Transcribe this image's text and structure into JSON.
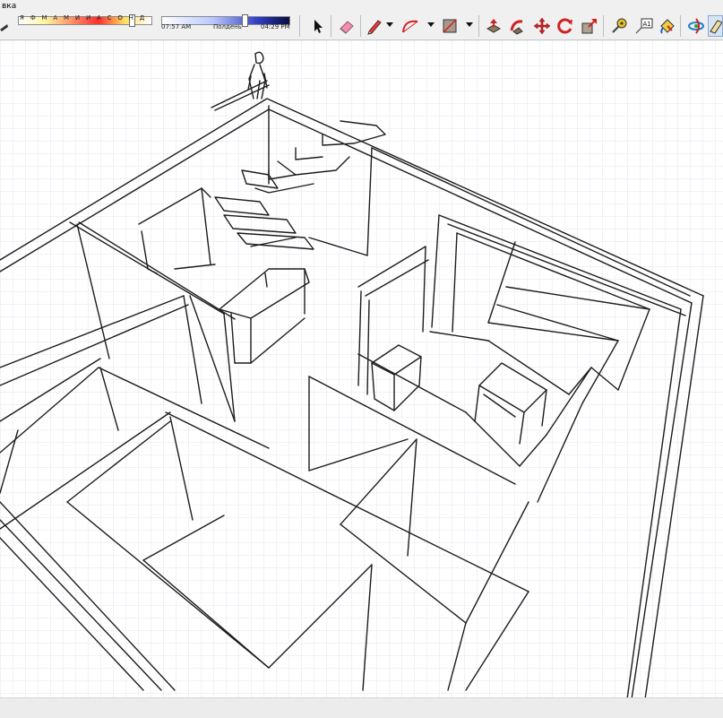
{
  "window": {
    "menu_title": "вка"
  },
  "shadow_settings": {
    "months_label": "Я Ф М А М И И А С О Н Д",
    "time_start": "07:57 AM",
    "time_mid": "Полдень",
    "time_end": "04:29 PM",
    "month_level": 0.85,
    "time_level": 0.65
  },
  "toolbar": {
    "tools": [
      {
        "id": "select",
        "icon": "select-arrow-icon"
      },
      {
        "id": "eraser",
        "icon": "eraser-icon"
      },
      {
        "id": "pencil",
        "icon": "pencil-icon"
      },
      {
        "id": "arc",
        "icon": "arc-icon"
      },
      {
        "id": "rectangle",
        "icon": "rectangle-icon"
      },
      {
        "id": "push-pull",
        "icon": "push-pull-icon"
      },
      {
        "id": "follow-me",
        "icon": "follow-me-icon"
      },
      {
        "id": "move",
        "icon": "move-icon"
      },
      {
        "id": "rotate",
        "icon": "rotate-icon"
      },
      {
        "id": "scale",
        "icon": "scale-icon"
      },
      {
        "id": "tape-measure",
        "icon": "tape-measure-icon"
      },
      {
        "id": "text",
        "icon": "text-icon",
        "label": "A1"
      },
      {
        "id": "paint-bucket",
        "icon": "paint-bucket-icon"
      },
      {
        "id": "orbit",
        "icon": "orbit-icon"
      },
      {
        "id": "section",
        "icon": "section-icon"
      }
    ]
  },
  "colors": {
    "viewport_bg": "#ffffff",
    "grid": "#e3e6ee",
    "sketch_line": "#1c1c1c",
    "toolbar_bg": "#f0f0f0"
  }
}
